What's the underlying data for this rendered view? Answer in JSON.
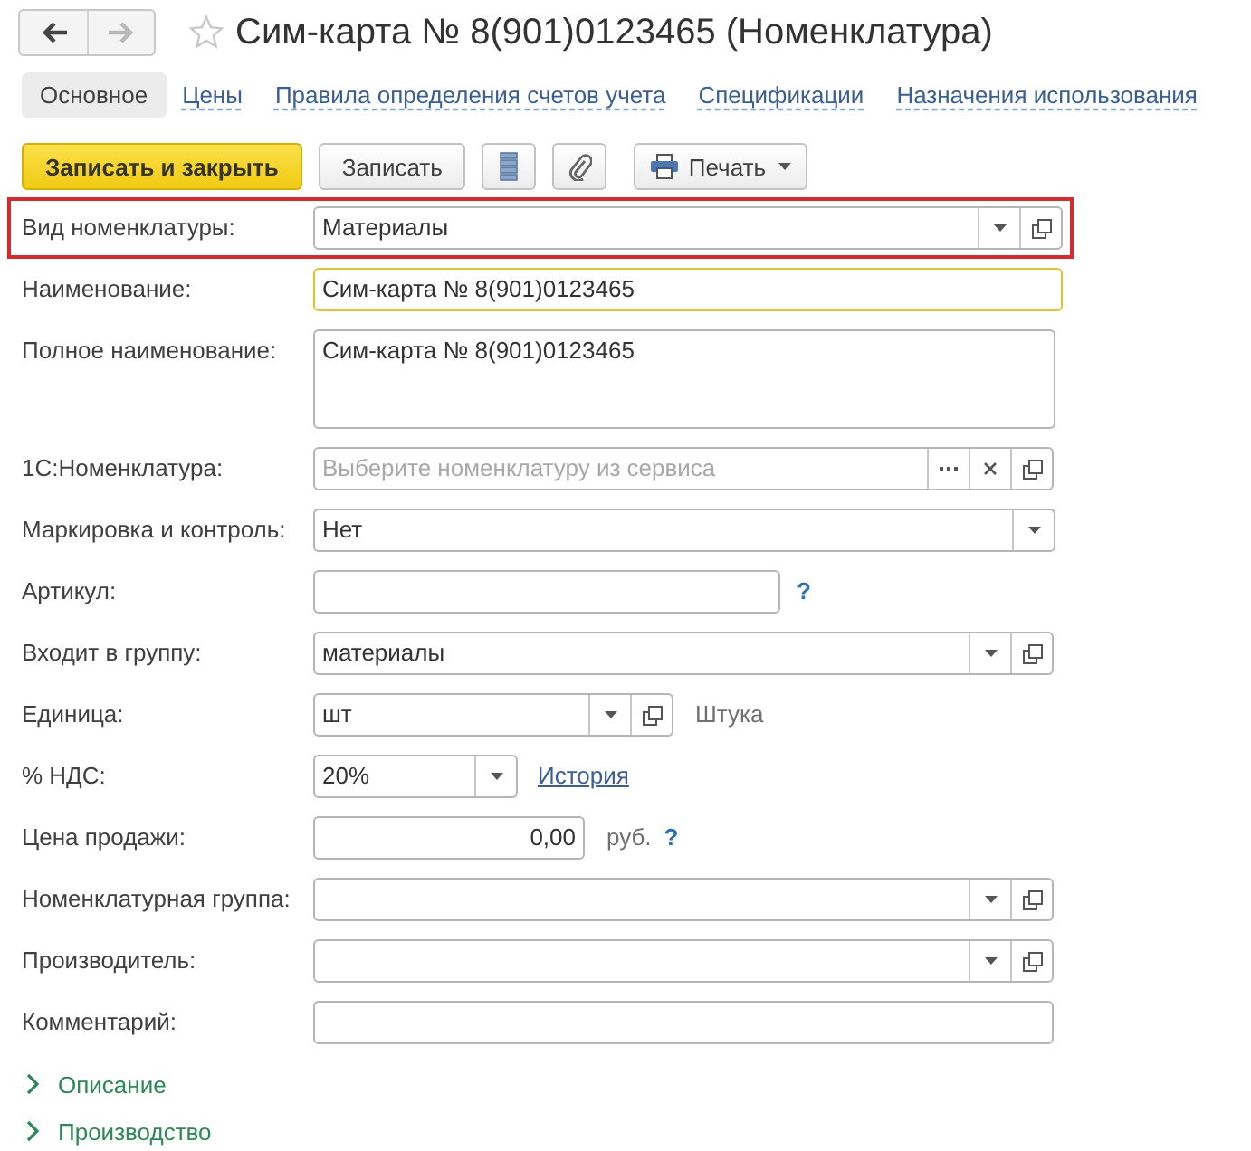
{
  "window": {
    "title": "Сим-карта № 8(901)0123465 (Номенклатура)",
    "favorite": false
  },
  "nav": [
    {
      "kind": "back",
      "disabled": false
    },
    {
      "kind": "forward",
      "disabled": true
    }
  ],
  "tabs": [
    {
      "label": "Основное",
      "selected": true
    },
    {
      "label": "Цены",
      "selected": false
    },
    {
      "label": "Правила определения счетов учета",
      "selected": false
    },
    {
      "label": "Спецификации",
      "selected": false
    },
    {
      "label": "Назначения использования",
      "selected": false
    }
  ],
  "toolbar": [
    {
      "kind": "primary",
      "label": "Записать и закрыть"
    },
    {
      "kind": "plain",
      "label": "Записать"
    },
    {
      "kind": "icon"
    },
    {
      "kind": "icon"
    },
    {
      "kind": "menu",
      "label": "Печать"
    }
  ],
  "fields": [
    {
      "kind": "select",
      "label": "Вид номенклатуры:",
      "value": "Материалы",
      "buttons": [
        {
          "kind": "dropdown"
        },
        {
          "kind": "open"
        }
      ],
      "highlighted": true,
      "focused": false
    },
    {
      "kind": "text",
      "label": "Наименование:",
      "value": "Сим-карта № 8(901)0123465",
      "highlighted": false,
      "focused": true
    },
    {
      "kind": "textarea",
      "label": "Полное наименование:",
      "value": "Сим-карта № 8(901)0123465",
      "highlighted": false,
      "focused": false
    },
    {
      "kind": "select",
      "label": "1С:Номенклатура:",
      "placeholder": "Выберите номенклатуру из сервиса",
      "buttons": [
        {
          "kind": "choose"
        },
        {
          "kind": "clear"
        },
        {
          "kind": "open"
        }
      ],
      "highlighted": false,
      "focused": false
    },
    {
      "kind": "select",
      "label": "Маркировка и контроль:",
      "value": "Нет",
      "buttons": [
        {
          "kind": "dropdown"
        }
      ],
      "highlighted": false,
      "focused": false
    },
    {
      "kind": "text",
      "label": "Артикул:",
      "extras": [
        {
          "kind": "help",
          "text": "?"
        }
      ],
      "highlighted": false,
      "focused": false
    },
    {
      "kind": "select",
      "label": "Входит в группу:",
      "value": "материалы",
      "buttons": [
        {
          "kind": "dropdown"
        },
        {
          "kind": "open"
        }
      ],
      "highlighted": false,
      "focused": false
    },
    {
      "kind": "select",
      "label": "Единица:",
      "value": "шт",
      "buttons": [
        {
          "kind": "dropdown"
        },
        {
          "kind": "open"
        }
      ],
      "extras": [
        {
          "kind": "note",
          "text": "Штука"
        }
      ],
      "highlighted": false,
      "focused": false
    },
    {
      "kind": "select",
      "label": "% НДС:",
      "value": "20%",
      "buttons": [
        {
          "kind": "dropdown"
        }
      ],
      "extras": [
        {
          "kind": "link",
          "text": "История"
        }
      ],
      "highlighted": false,
      "focused": false
    },
    {
      "kind": "number",
      "label": "Цена продажи:",
      "value": "0,00",
      "extras": [
        {
          "kind": "note",
          "text": "руб."
        },
        {
          "kind": "help",
          "text": "?"
        }
      ],
      "highlighted": false,
      "focused": false
    },
    {
      "kind": "select",
      "label": "Номенклатурная группа:",
      "buttons": [
        {
          "kind": "dropdown"
        },
        {
          "kind": "open"
        }
      ],
      "highlighted": false,
      "focused": false
    },
    {
      "kind": "select",
      "label": "Производитель:",
      "buttons": [
        {
          "kind": "dropdown"
        },
        {
          "kind": "open"
        }
      ],
      "highlighted": false,
      "focused": false
    },
    {
      "kind": "text",
      "label": "Комментарий:",
      "highlighted": false,
      "focused": false
    }
  ],
  "sections": [
    {
      "label": "Описание",
      "expanded": false
    },
    {
      "label": "Производство",
      "expanded": false
    }
  ]
}
